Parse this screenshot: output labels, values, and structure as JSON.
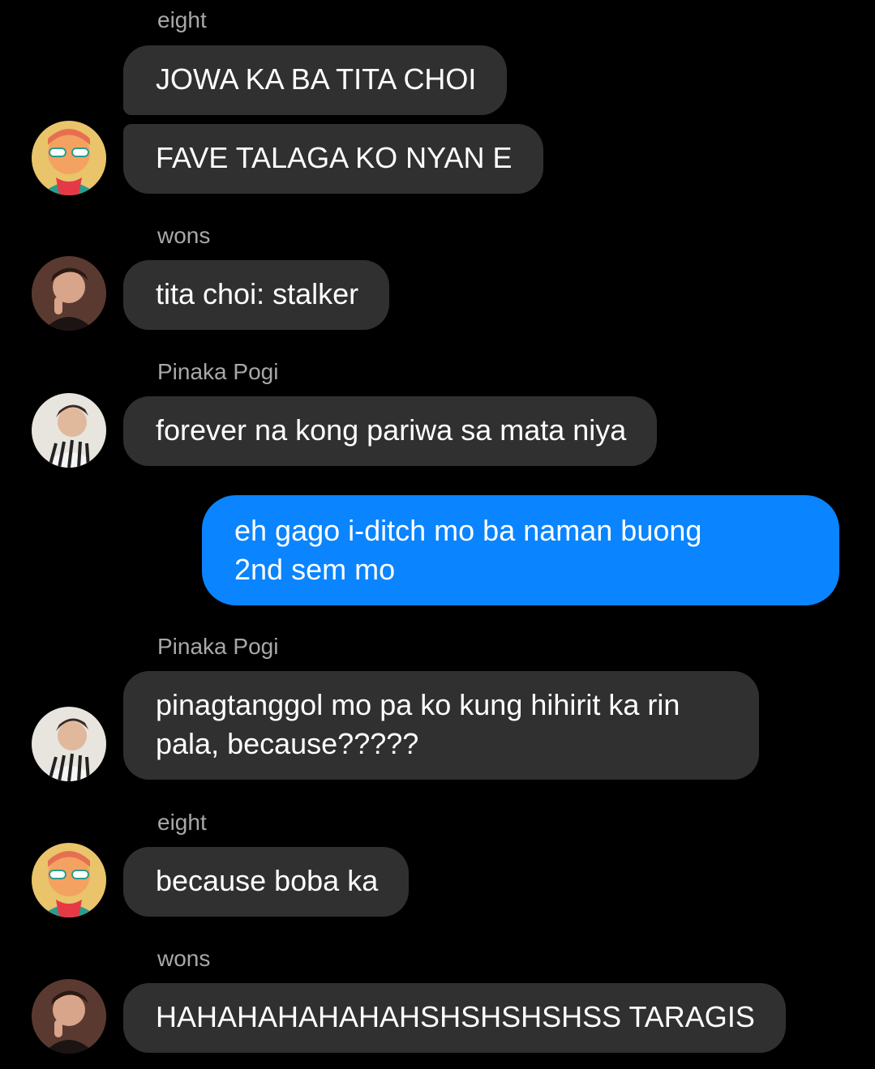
{
  "messages": [
    {
      "sender": "eight"
    },
    {
      "text": "JOWA KA BA TITA CHOI"
    },
    {
      "text": "FAVE TALAGA KO NYAN E"
    },
    {
      "sender": "wons"
    },
    {
      "text": "tita choi: stalker"
    },
    {
      "sender": "Pinaka Pogi"
    },
    {
      "text": "forever na kong pariwa sa mata niya"
    },
    {
      "text_lines": [
        "eh gago i-ditch mo ba naman buong",
        "2nd sem mo"
      ]
    },
    {
      "sender": "Pinaka Pogi"
    },
    {
      "text_lines": [
        "pinagtanggol mo pa ko kung hihirit ka rin",
        "pala, because?????"
      ]
    },
    {
      "sender": "eight"
    },
    {
      "text": "because boba ka"
    },
    {
      "sender": "wons"
    },
    {
      "text": "HAHAHAHAHAHAHSHSHSHSHSS TARAGIS"
    }
  ],
  "colors": {
    "background": "#000000",
    "incoming_bubble": "#303030",
    "outgoing_bubble": "#0a84ff",
    "sender_name": "#a8a8a8"
  },
  "avatars": [
    "eight-avatar",
    "wons-avatar",
    "pinaka-pogi-avatar",
    "pinaka-pogi-avatar",
    "eight-avatar",
    "wons-avatar"
  ]
}
